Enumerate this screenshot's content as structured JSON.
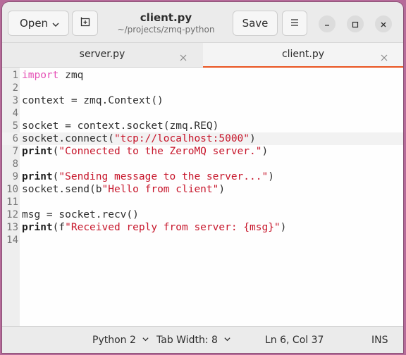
{
  "header": {
    "open_label": "Open",
    "save_label": "Save",
    "title": "client.py",
    "subtitle": "~/projects/zmq-python"
  },
  "tabs": [
    {
      "label": "server.py",
      "active": false
    },
    {
      "label": "client.py",
      "active": true
    }
  ],
  "editor": {
    "current_line": 6,
    "lines": [
      {
        "n": "1",
        "segments": [
          [
            "kw",
            "import"
          ],
          [
            "",
            " zmq"
          ]
        ]
      },
      {
        "n": "2",
        "segments": []
      },
      {
        "n": "3",
        "segments": [
          [
            "",
            "context = zmq.Context()"
          ]
        ]
      },
      {
        "n": "4",
        "segments": []
      },
      {
        "n": "5",
        "segments": [
          [
            "",
            "socket = context.socket(zmq.REQ)"
          ]
        ]
      },
      {
        "n": "6",
        "segments": [
          [
            "",
            "socket.connect("
          ],
          [
            "str",
            "\"tcp://localhost:5000\""
          ],
          [
            "",
            ")"
          ]
        ]
      },
      {
        "n": "7",
        "segments": [
          [
            "bi",
            "print"
          ],
          [
            "",
            "("
          ],
          [
            "str",
            "\"Connected to the ZeroMQ server.\""
          ],
          [
            "",
            ")"
          ]
        ]
      },
      {
        "n": "8",
        "segments": []
      },
      {
        "n": "9",
        "segments": [
          [
            "bi",
            "print"
          ],
          [
            "",
            "("
          ],
          [
            "str",
            "\"Sending message to the server...\""
          ],
          [
            "",
            ")"
          ]
        ]
      },
      {
        "n": "10",
        "segments": [
          [
            "",
            "socket.send(b"
          ],
          [
            "str",
            "\"Hello from client\""
          ],
          [
            "",
            ")"
          ]
        ]
      },
      {
        "n": "11",
        "segments": []
      },
      {
        "n": "12",
        "segments": [
          [
            "",
            "msg = socket.recv()"
          ]
        ]
      },
      {
        "n": "13",
        "segments": [
          [
            "bi",
            "print"
          ],
          [
            "",
            "(f"
          ],
          [
            "str",
            "\"Received reply from server: {msg}\""
          ],
          [
            "",
            ")"
          ]
        ]
      },
      {
        "n": "14",
        "segments": []
      }
    ]
  },
  "statusbar": {
    "language": "Python 2",
    "tab_width": "Tab Width: 8",
    "position": "Ln 6, Col 37",
    "mode": "INS"
  },
  "colors": {
    "accent": "#e95420",
    "keyword": "#e552b6",
    "string": "#c7162b"
  },
  "icons": [
    "chevron-down-icon",
    "new-tab-icon",
    "hamburger-menu-icon",
    "minimize-icon",
    "maximize-icon",
    "close-icon"
  ]
}
